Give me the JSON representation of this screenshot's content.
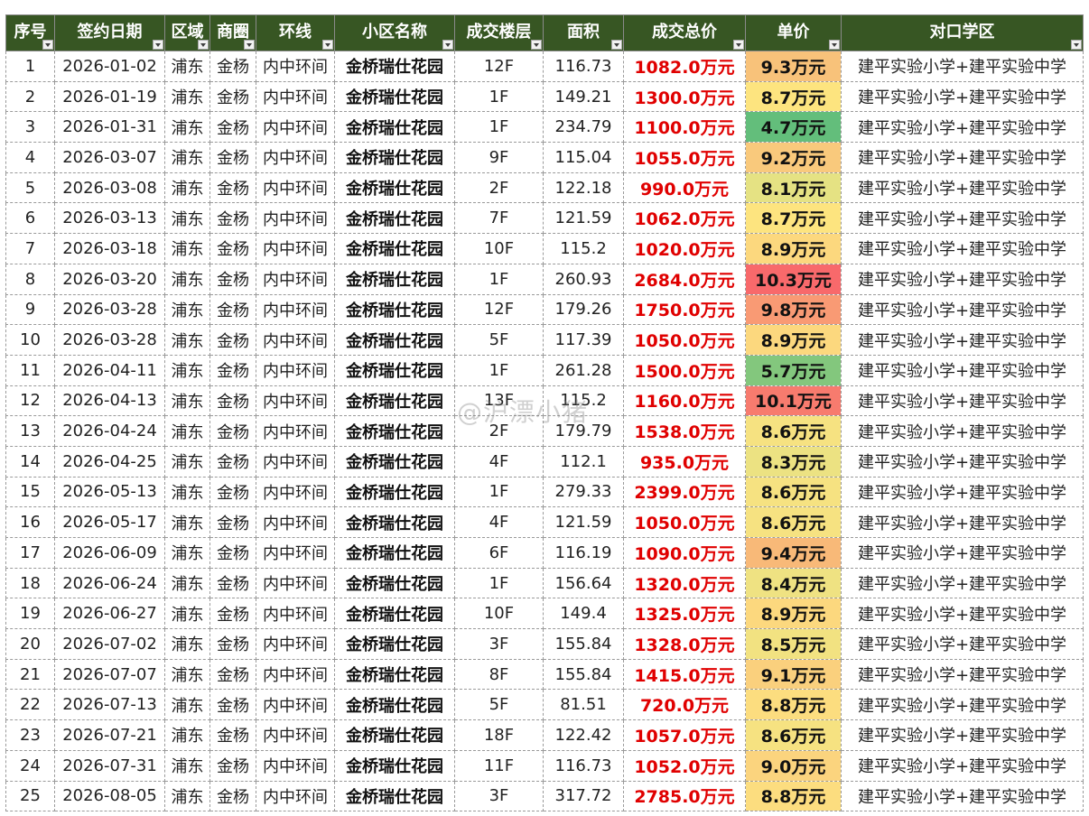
{
  "table": {
    "headers": [
      "序号",
      "签约日期",
      "区域",
      "商圈",
      "环线",
      "小区名称",
      "成交楼层",
      "面积",
      "成交总价",
      "单价",
      "对口学区"
    ],
    "header_color": "#375623",
    "price_color": "#e00000",
    "rows": [
      {
        "no": "1",
        "date": "2026-01-02",
        "area": "浦东",
        "circle": "金杨",
        "ring": "内中环间",
        "name": "金桥瑞仕花园",
        "floor": "12F",
        "size": "116.73",
        "price": "1082.0万元",
        "unit": "9.3万元",
        "unit_color": "#f8c27a",
        "school": "建平实验小学+建平实验中学"
      },
      {
        "no": "2",
        "date": "2026-01-19",
        "area": "浦东",
        "circle": "金杨",
        "ring": "内中环间",
        "name": "金桥瑞仕花园",
        "floor": "1F",
        "size": "149.21",
        "price": "1300.0万元",
        "unit": "8.7万元",
        "unit_color": "#fde47f",
        "school": "建平实验小学+建平实验中学"
      },
      {
        "no": "3",
        "date": "2026-01-31",
        "area": "浦东",
        "circle": "金杨",
        "ring": "内中环间",
        "name": "金桥瑞仕花园",
        "floor": "1F",
        "size": "234.79",
        "price": "1100.0万元",
        "unit": "4.7万元",
        "unit_color": "#63be7b",
        "school": "建平实验小学+建平实验中学"
      },
      {
        "no": "4",
        "date": "2026-03-07",
        "area": "浦东",
        "circle": "金杨",
        "ring": "内中环间",
        "name": "金桥瑞仕花园",
        "floor": "9F",
        "size": "115.04",
        "price": "1055.0万元",
        "unit": "9.2万元",
        "unit_color": "#f9c97c",
        "school": "建平实验小学+建平实验中学"
      },
      {
        "no": "5",
        "date": "2026-03-08",
        "area": "浦东",
        "circle": "金杨",
        "ring": "内中环间",
        "name": "金桥瑞仕花园",
        "floor": "2F",
        "size": "122.18",
        "price": "990.0万元",
        "unit": "8.1万元",
        "unit_color": "#e5e283",
        "school": "建平实验小学+建平实验中学"
      },
      {
        "no": "6",
        "date": "2026-03-13",
        "area": "浦东",
        "circle": "金杨",
        "ring": "内中环间",
        "name": "金桥瑞仕花园",
        "floor": "7F",
        "size": "121.59",
        "price": "1062.0万元",
        "unit": "8.7万元",
        "unit_color": "#fde47f",
        "school": "建平实验小学+建平实验中学"
      },
      {
        "no": "7",
        "date": "2026-03-18",
        "area": "浦东",
        "circle": "金杨",
        "ring": "内中环间",
        "name": "金桥瑞仕花园",
        "floor": "10F",
        "size": "115.2",
        "price": "1020.0万元",
        "unit": "8.9万元",
        "unit_color": "#fcd87e",
        "school": "建平实验小学+建平实验中学"
      },
      {
        "no": "8",
        "date": "2026-03-20",
        "area": "浦东",
        "circle": "金杨",
        "ring": "内中环间",
        "name": "金桥瑞仕花园",
        "floor": "1F",
        "size": "260.93",
        "price": "2684.0万元",
        "unit": "10.3万元",
        "unit_color": "#f8696b",
        "school": "建平实验小学+建平实验中学"
      },
      {
        "no": "9",
        "date": "2026-03-28",
        "area": "浦东",
        "circle": "金杨",
        "ring": "内中环间",
        "name": "金桥瑞仕花园",
        "floor": "12F",
        "size": "179.26",
        "price": "1750.0万元",
        "unit": "9.8万元",
        "unit_color": "#f99a74",
        "school": "建平实验小学+建平实验中学"
      },
      {
        "no": "10",
        "date": "2026-03-28",
        "area": "浦东",
        "circle": "金杨",
        "ring": "内中环间",
        "name": "金桥瑞仕花园",
        "floor": "5F",
        "size": "117.39",
        "price": "1050.0万元",
        "unit": "8.9万元",
        "unit_color": "#fcd87e",
        "school": "建平实验小学+建平实验中学"
      },
      {
        "no": "11",
        "date": "2026-04-11",
        "area": "浦东",
        "circle": "金杨",
        "ring": "内中环间",
        "name": "金桥瑞仕花园",
        "floor": "1F",
        "size": "261.28",
        "price": "1500.0万元",
        "unit": "5.7万元",
        "unit_color": "#83c77d",
        "school": "建平实验小学+建平实验中学"
      },
      {
        "no": "12",
        "date": "2026-04-13",
        "area": "浦东",
        "circle": "金杨",
        "ring": "内中环间",
        "name": "金桥瑞仕花园",
        "floor": "13F",
        "size": "115.2",
        "price": "1160.0万元",
        "unit": "10.1万元",
        "unit_color": "#f77b6e",
        "school": "建平实验小学+建平实验中学"
      },
      {
        "no": "13",
        "date": "2026-04-24",
        "area": "浦东",
        "circle": "金杨",
        "ring": "内中环间",
        "name": "金桥瑞仕花园",
        "floor": "2F",
        "size": "179.79",
        "price": "1538.0万元",
        "unit": "8.6万元",
        "unit_color": "#f6e281",
        "school": "建平实验小学+建平实验中学"
      },
      {
        "no": "14",
        "date": "2026-04-25",
        "area": "浦东",
        "circle": "金杨",
        "ring": "内中环间",
        "name": "金桥瑞仕花园",
        "floor": "4F",
        "size": "112.1",
        "price": "935.0万元",
        "unit": "8.3万元",
        "unit_color": "#ece282",
        "school": "建平实验小学+建平实验中学"
      },
      {
        "no": "15",
        "date": "2026-05-13",
        "area": "浦东",
        "circle": "金杨",
        "ring": "内中环间",
        "name": "金桥瑞仕花园",
        "floor": "1F",
        "size": "279.33",
        "price": "2399.0万元",
        "unit": "8.6万元",
        "unit_color": "#f6e281",
        "school": "建平实验小学+建平实验中学"
      },
      {
        "no": "16",
        "date": "2026-05-17",
        "area": "浦东",
        "circle": "金杨",
        "ring": "内中环间",
        "name": "金桥瑞仕花园",
        "floor": "4F",
        "size": "121.59",
        "price": "1050.0万元",
        "unit": "8.6万元",
        "unit_color": "#f6e281",
        "school": "建平实验小学+建平实验中学"
      },
      {
        "no": "17",
        "date": "2026-06-09",
        "area": "浦东",
        "circle": "金杨",
        "ring": "内中环间",
        "name": "金桥瑞仕花园",
        "floor": "6F",
        "size": "116.19",
        "price": "1090.0万元",
        "unit": "9.4万元",
        "unit_color": "#f8b978",
        "school": "建平实验小学+建平实验中学"
      },
      {
        "no": "18",
        "date": "2026-06-24",
        "area": "浦东",
        "circle": "金杨",
        "ring": "内中环间",
        "name": "金桥瑞仕花园",
        "floor": "1F",
        "size": "156.64",
        "price": "1320.0万元",
        "unit": "8.4万元",
        "unit_color": "#efe282",
        "school": "建平实验小学+建平实验中学"
      },
      {
        "no": "19",
        "date": "2026-06-27",
        "area": "浦东",
        "circle": "金杨",
        "ring": "内中环间",
        "name": "金桥瑞仕花园",
        "floor": "10F",
        "size": "149.4",
        "price": "1325.0万元",
        "unit": "8.9万元",
        "unit_color": "#fcd87e",
        "school": "建平实验小学+建平实验中学"
      },
      {
        "no": "20",
        "date": "2026-07-02",
        "area": "浦东",
        "circle": "金杨",
        "ring": "内中环间",
        "name": "金桥瑞仕花园",
        "floor": "3F",
        "size": "155.84",
        "price": "1328.0万元",
        "unit": "8.5万元",
        "unit_color": "#f2e281",
        "school": "建平实验小学+建平实验中学"
      },
      {
        "no": "21",
        "date": "2026-07-07",
        "area": "浦东",
        "circle": "金杨",
        "ring": "内中环间",
        "name": "金桥瑞仕花园",
        "floor": "8F",
        "size": "155.84",
        "price": "1415.0万元",
        "unit": "9.1万元",
        "unit_color": "#fad07d",
        "school": "建平实验小学+建平实验中学"
      },
      {
        "no": "22",
        "date": "2026-07-13",
        "area": "浦东",
        "circle": "金杨",
        "ring": "内中环间",
        "name": "金桥瑞仕花园",
        "floor": "5F",
        "size": "81.51",
        "price": "720.0万元",
        "unit": "8.8万元",
        "unit_color": "#fcdd7f",
        "school": "建平实验小学+建平实验中学"
      },
      {
        "no": "23",
        "date": "2026-07-21",
        "area": "浦东",
        "circle": "金杨",
        "ring": "内中环间",
        "name": "金桥瑞仕花园",
        "floor": "18F",
        "size": "122.42",
        "price": "1057.0万元",
        "unit": "8.6万元",
        "unit_color": "#f6e281",
        "school": "建平实验小学+建平实验中学"
      },
      {
        "no": "24",
        "date": "2026-07-31",
        "area": "浦东",
        "circle": "金杨",
        "ring": "内中环间",
        "name": "金桥瑞仕花园",
        "floor": "11F",
        "size": "116.73",
        "price": "1052.0万元",
        "unit": "9.0万元",
        "unit_color": "#fbd47e",
        "school": "建平实验小学+建平实验中学"
      },
      {
        "no": "25",
        "date": "2026-08-05",
        "area": "浦东",
        "circle": "金杨",
        "ring": "内中环间",
        "name": "金桥瑞仕花园",
        "floor": "3F",
        "size": "317.72",
        "price": "2785.0万元",
        "unit": "8.8万元",
        "unit_color": "#fcdd7f",
        "school": "建平实验小学+建平实验中学"
      }
    ]
  },
  "watermark": "@沪漂小猪"
}
